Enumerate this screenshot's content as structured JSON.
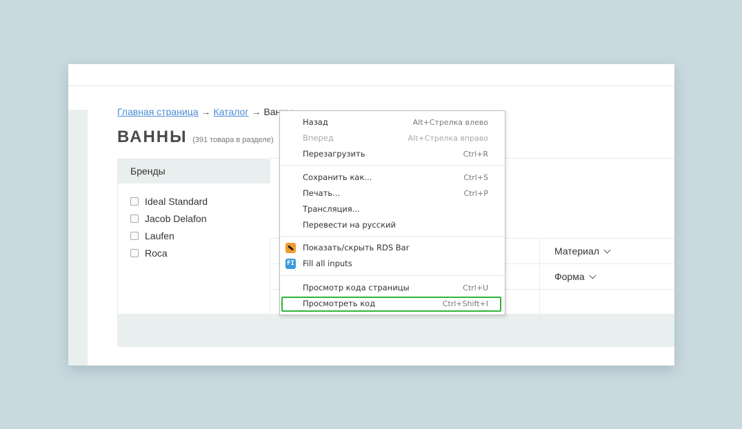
{
  "breadcrumb": {
    "home": "Главная страница",
    "catalog": "Каталог",
    "current": "Ванны",
    "separator": "→"
  },
  "page": {
    "title": "ВАННЫ",
    "count": "(391 товара в разделе)"
  },
  "filters": {
    "brands_title": "Бренды",
    "brands": [
      "Ideal Standard",
      "Jacob Delafon",
      "Laufen",
      "Roca"
    ],
    "material": "Материал",
    "shape": "Форма"
  },
  "context_menu": {
    "items": [
      {
        "label": "Назад",
        "shortcut": "Alt+Стрелка влево",
        "enabled": true
      },
      {
        "label": "Вперед",
        "shortcut": "Alt+Стрелка вправо",
        "enabled": false
      },
      {
        "label": "Перезагрузить",
        "shortcut": "Ctrl+R",
        "enabled": true
      },
      {
        "label": "Сохранить как...",
        "shortcut": "Ctrl+S",
        "enabled": true
      },
      {
        "label": "Печать...",
        "shortcut": "Ctrl+P",
        "enabled": true
      },
      {
        "label": "Трансляция...",
        "shortcut": "",
        "enabled": true
      },
      {
        "label": "Перевести на русский",
        "shortcut": "",
        "enabled": true
      },
      {
        "label": "Показать/скрыть RDS Bar",
        "shortcut": "",
        "enabled": true,
        "icon": "rds-bar-icon"
      },
      {
        "label": "Fill all inputs",
        "shortcut": "",
        "enabled": true,
        "icon": "fill-inputs-icon"
      },
      {
        "label": "Просмотр кода страницы",
        "shortcut": "Ctrl+U",
        "enabled": true
      },
      {
        "label": "Просмотреть код",
        "shortcut": "Ctrl+Shift+I",
        "enabled": true,
        "highlighted": true
      }
    ],
    "fill_icon_text": "FI"
  },
  "colors": {
    "background": "#c9d9df",
    "link": "#4b8cd6",
    "highlight": "#2db43a",
    "panel": "#e8efee"
  }
}
